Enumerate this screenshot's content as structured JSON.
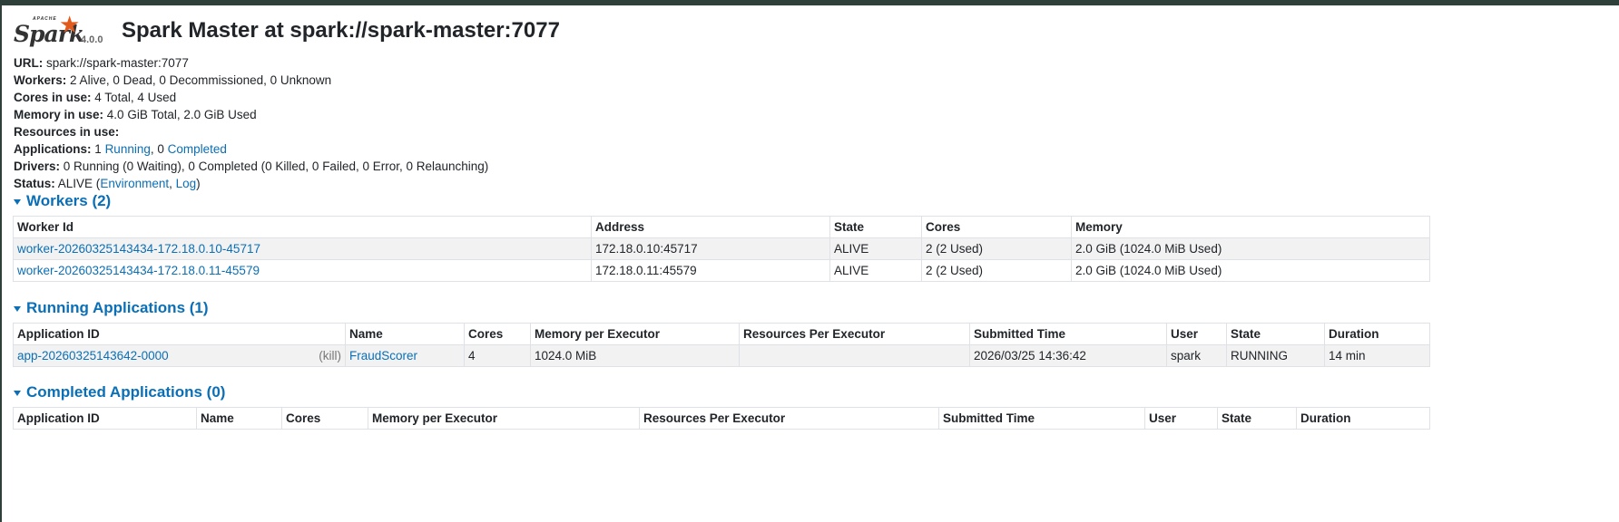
{
  "header": {
    "logo_apache": "APACHE",
    "logo_word": "Spark",
    "version": "4.0.0",
    "title": "Spark Master at spark://spark-master:7077"
  },
  "info": {
    "url_label": "URL:",
    "url_value": "spark://spark-master:7077",
    "workers_label": "Workers:",
    "workers_value": "2 Alive, 0 Dead, 0 Decommissioned, 0 Unknown",
    "cores_label": "Cores in use:",
    "cores_value": "4 Total, 4 Used",
    "memory_label": "Memory in use:",
    "memory_value": "4.0 GiB Total, 2.0 GiB Used",
    "resources_label": "Resources in use:",
    "applications_label": "Applications:",
    "applications_prefix": "1",
    "applications_running": "Running",
    "applications_mid": ", 0",
    "applications_completed": "Completed",
    "drivers_label": "Drivers:",
    "drivers_value": "0 Running (0 Waiting), 0 Completed (0 Killed, 0 Failed, 0 Error, 0 Relaunching)",
    "status_label": "Status:",
    "status_prefix": "ALIVE (",
    "status_environment": "Environment",
    "status_sep": ", ",
    "status_log": "Log",
    "status_suffix": ")"
  },
  "workers": {
    "heading": "Workers (2)",
    "columns": [
      "Worker Id",
      "Address",
      "State",
      "Cores",
      "Memory"
    ],
    "rows": [
      {
        "id": "worker-20260325143434-172.18.0.10-45717",
        "address": "172.18.0.10:45717",
        "state": "ALIVE",
        "cores": "2 (2 Used)",
        "memory": "2.0 GiB (1024.0 MiB Used)"
      },
      {
        "id": "worker-20260325143434-172.18.0.11-45579",
        "address": "172.18.0.11:45579",
        "state": "ALIVE",
        "cores": "2 (2 Used)",
        "memory": "2.0 GiB (1024.0 MiB Used)"
      }
    ]
  },
  "running": {
    "heading": "Running Applications (1)",
    "columns": [
      "Application ID",
      "Name",
      "Cores",
      "Memory per Executor",
      "Resources Per Executor",
      "Submitted Time",
      "User",
      "State",
      "Duration"
    ],
    "rows": [
      {
        "app_id": "app-20260325143642-0000",
        "kill": "(kill)",
        "name": "FraudScorer",
        "cores": "4",
        "memory": "1024.0 MiB",
        "resources": "",
        "submitted": "2026/03/25 14:36:42",
        "user": "spark",
        "state": "RUNNING",
        "duration": "14 min"
      }
    ]
  },
  "completed": {
    "heading": "Completed Applications (0)",
    "columns": [
      "Application ID",
      "Name",
      "Cores",
      "Memory per Executor",
      "Resources Per Executor",
      "Submitted Time",
      "User",
      "State",
      "Duration"
    ]
  },
  "colors": {
    "link": "#0a6fb6",
    "logo_star": "#e25a1c",
    "topbar": "#2f3f3a"
  }
}
